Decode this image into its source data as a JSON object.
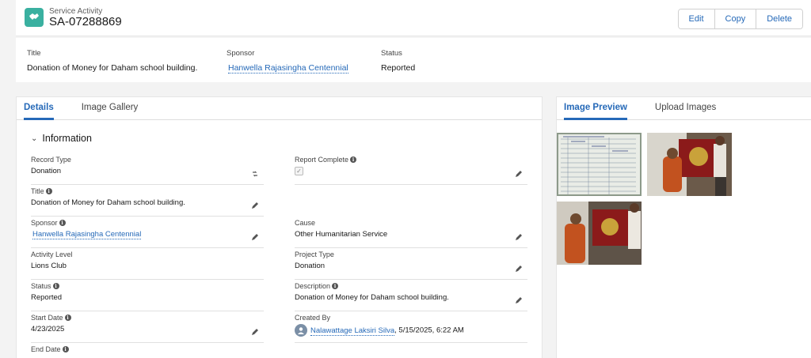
{
  "header": {
    "object_type": "Service Activity",
    "record_name": "SA-07288869",
    "actions": [
      "Edit",
      "Copy",
      "Delete"
    ]
  },
  "highlights": [
    {
      "label": "Title",
      "value": "Donation of Money for Daham school building."
    },
    {
      "label": "Sponsor",
      "value": "Hanwella Rajasingha Centennial"
    },
    {
      "label": "Status",
      "value": "Reported"
    }
  ],
  "left_tabs": [
    "Details",
    "Image Gallery"
  ],
  "section_title": "Information",
  "fields": {
    "record_type": {
      "label": "Record Type",
      "value": "Donation"
    },
    "report_complete": {
      "label": "Report Complete",
      "value": "✓"
    },
    "title": {
      "label": "Title",
      "value": "Donation of Money for Daham school building."
    },
    "sponsor": {
      "label": "Sponsor",
      "value": "Hanwella Rajasingha Centennial"
    },
    "cause": {
      "label": "Cause",
      "value": "Other Humanitarian Service"
    },
    "activity_level": {
      "label": "Activity Level",
      "value": "Lions Club"
    },
    "project_type": {
      "label": "Project Type",
      "value": "Donation"
    },
    "status": {
      "label": "Status",
      "value": "Reported"
    },
    "description": {
      "label": "Description",
      "value": "Donation of Money for Daham school building."
    },
    "start_date": {
      "label": "Start Date",
      "value": "4/23/2025"
    },
    "created_by": {
      "label": "Created By",
      "user": "Nalawattage Laksiri Silva",
      "timestamp": ", 5/15/2025, 6:22 AM"
    },
    "end_date": {
      "label": "End Date"
    }
  },
  "right_tabs": [
    "Image Preview",
    "Upload Images"
  ],
  "colors": {
    "accent": "#2569b8",
    "icon_bg": "#3ab0a0"
  }
}
